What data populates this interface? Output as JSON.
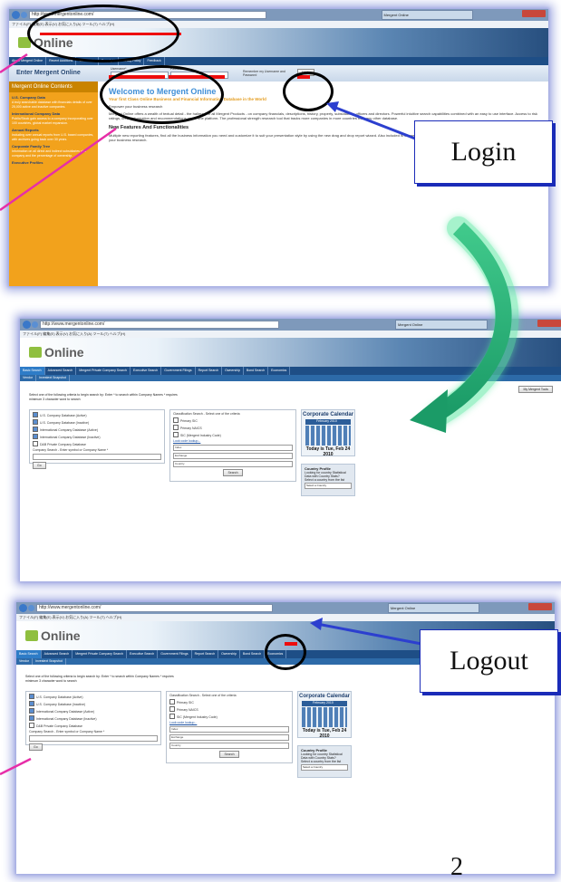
{
  "callouts": {
    "login": "Login",
    "logout": "Logout"
  },
  "page_number": "2",
  "browser": {
    "url": "http://www.mergentonline.com/",
    "tab": "Mergent Online",
    "search": "Google",
    "menu": "ファイル(F)  編集(E)  表示(V)  お気に入り(A)  ツール(T)  ヘルプ(H)"
  },
  "shot1": {
    "logo": "Online",
    "enter_label": "Enter Mergent Online",
    "username_label": "Username*",
    "password_label": "Password*",
    "remember_label": "Remember my Username and Password",
    "login_button": "Login",
    "nav": [
      "About Mergent Online",
      "Recent Additions",
      "Contact Us",
      "Copyright",
      "Privacy Policy",
      "Feedback"
    ],
    "sidebar_head": "Mergent Online Contents",
    "sidebar_sections": [
      {
        "title": "U.S. Company Data",
        "text": "A truly searchable database with financials details of over 25,000 active and inactive companies."
      },
      {
        "title": "International Company Data",
        "text": "Public/Stock gain access to a company incorporating over 100 countries, global market expansion."
      },
      {
        "title": "Annual Reports",
        "text": "Including over annual reports from U.S. based companies, with archives going back over 30 years."
      },
      {
        "title": "Corporate Family Tree",
        "text": "Information on all direct and indirect subsidiaries of a company and the percentage of ownership."
      },
      {
        "title": "Executive Profiles",
        "text": ""
      }
    ],
    "welcome": "Welcome to Mergent Online",
    "tagline": "Your first Class Online Business and Financial Information Database in the World",
    "tagline2": "Empower your business research",
    "intro": "Mergent Online offers a wealth of textual detail - the hallmark of all Mergent Products - on company financials, descriptions, history, property, subsidiaries, officers and directors. Powerful intuitive search capabilities combined with an easy to use interface. Access to risk ratings, credit information and recommendations under one platform. The professional strength research tool that tracks more companies in more countries than any other database.",
    "features_heading": "New Features And Functionalities",
    "features_text": "Multiple new reporting features, find all the business information you need and customize it to suit your presentation style by using the new drag and drop report wizard. Also included is Mergent's revamped pre defined reports, as well custom and comparison reports for your business research."
  },
  "shot23": {
    "logo": "Online",
    "nav": [
      "Basic Search",
      "Advanced Search",
      "Mergent Private Company Search",
      "Executive Search",
      "Government Filings",
      "Report Search",
      "Ownership",
      "Bond Search",
      "Economics"
    ],
    "subnav": [
      "Vendor",
      "Investext Snapshot"
    ],
    "tools_button": "My Mergent Tools",
    "instructions": "Select one of the following criteria to begin search by: Enter * to search within Company Names * requires minimum 3 character word to search",
    "databases": [
      {
        "label": "U.S. Company Database (Active)",
        "checked": true
      },
      {
        "label": "U.S. Company Database (Inactive)",
        "checked": true
      },
      {
        "label": "International Company Database (Active)",
        "checked": true
      },
      {
        "label": "International Company Database (Inactive)",
        "checked": true
      },
      {
        "label": "D&B Private Company Database",
        "checked": false
      }
    ],
    "company_search_label": "Company Search - Enter symbol or Company Name *",
    "go_button": "Go",
    "classification_label": "Classification Search - Select one of the criteria",
    "classifications": [
      "Primary SIC",
      "Primary NAICS",
      "SIC (Mergent Industry Code)"
    ],
    "code_lookup": "Look code lookup...",
    "index_label": "Index",
    "exchange_label": "Exchange",
    "country_label": "Country",
    "search_button": "Search",
    "calendar_title": "Corporate Calendar",
    "calendar_month": "February",
    "calendar_year": "2010",
    "today": "Today is Tue, Feb 24 2010",
    "cp_title": "Country Profile",
    "cp_text": "Looking for country Statistical Data with Country Stats?",
    "cp_select_label": "Select a country from the list",
    "cp_select": "Select a Country"
  }
}
